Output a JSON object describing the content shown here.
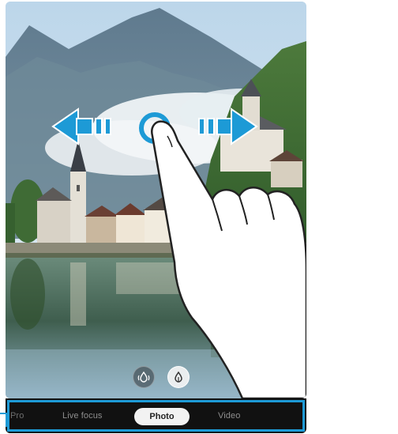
{
  "camera": {
    "modes": {
      "pro": "Pro",
      "live_focus": "Live focus",
      "photo": "Photo",
      "video": "Video"
    },
    "selected_mode": "Photo",
    "lens_buttons": {
      "wide_icon": "ultra-wide-lens-icon",
      "standard_icon": "wide-lens-icon"
    },
    "gesture": {
      "type": "swipe-left-right",
      "hand_icon": "pointing-hand-icon",
      "left_arrow_icon": "arrow-left-icon",
      "right_arrow_icon": "arrow-right-icon"
    }
  },
  "colors": {
    "arrow_fill": "#1d9ad6",
    "highlight_border": "#1d9ad6",
    "mode_bar_bg": "#111111"
  }
}
